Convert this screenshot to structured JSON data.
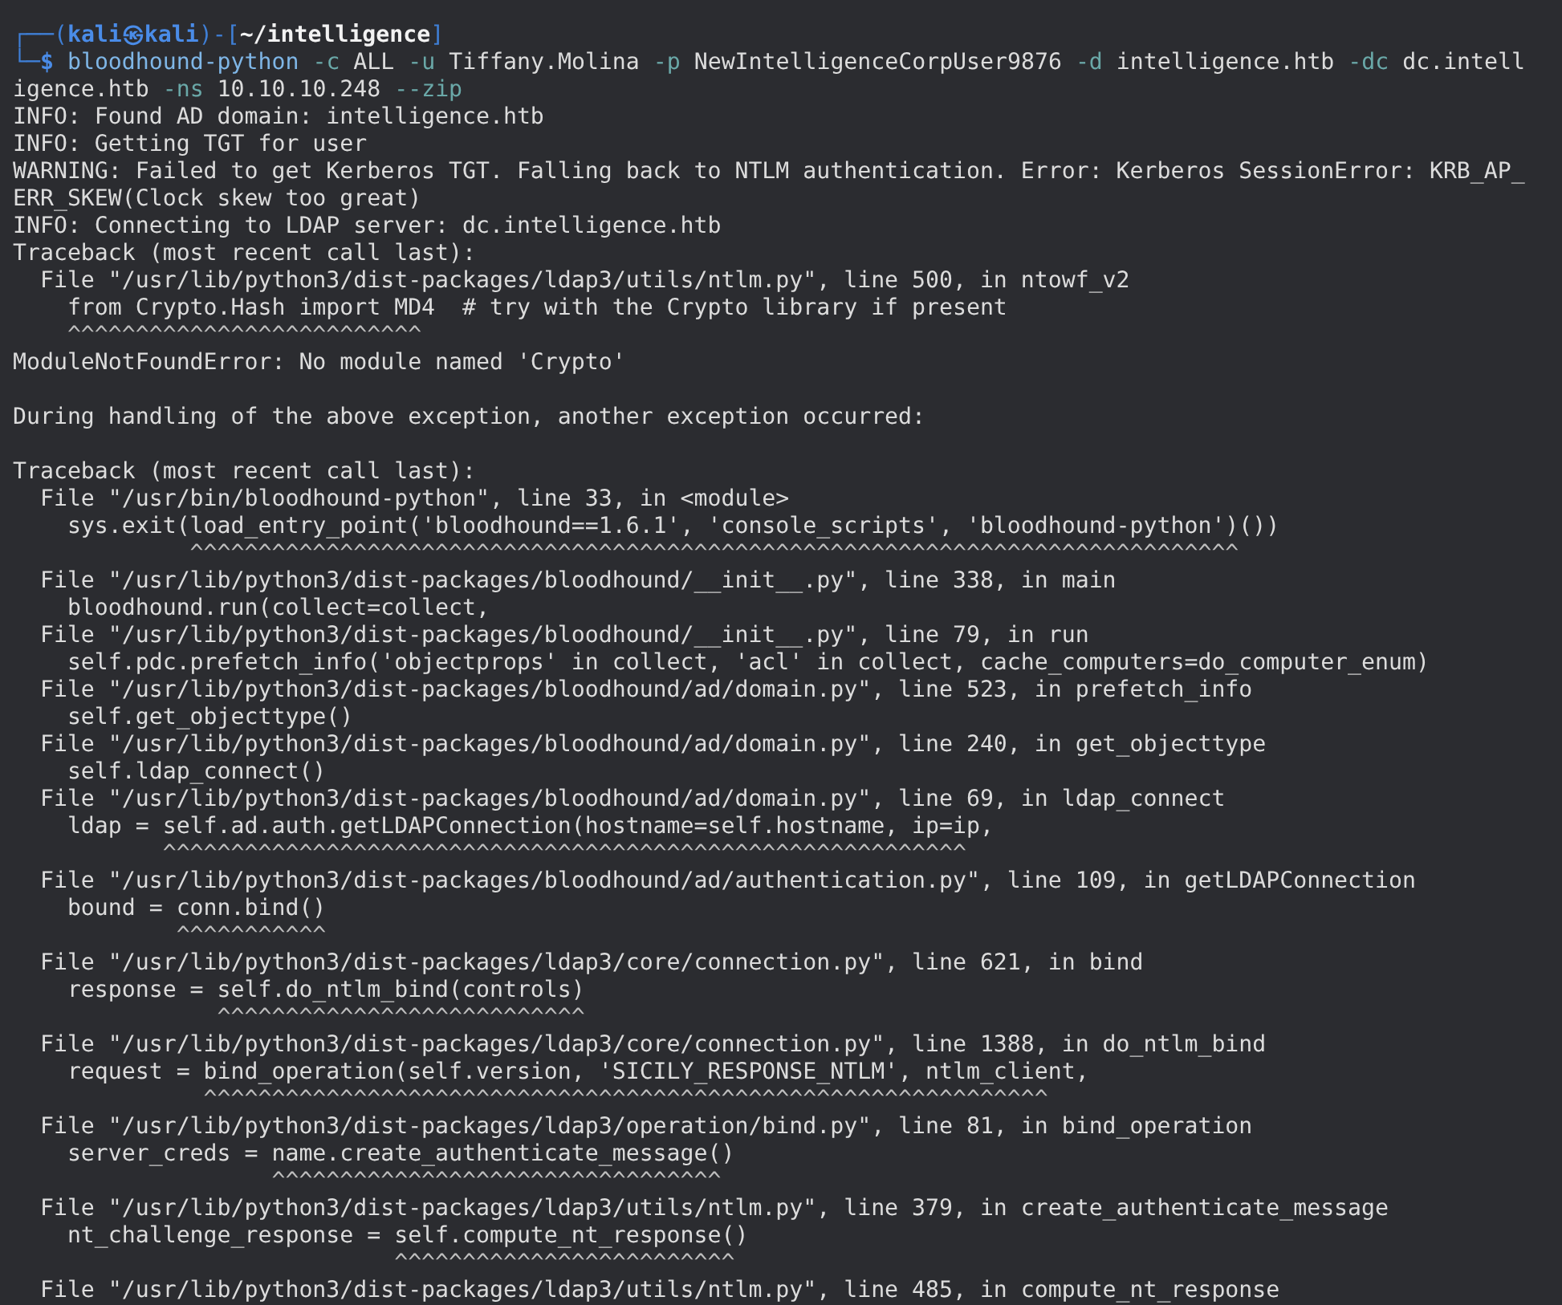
{
  "terminal": {
    "prompt": [
      {
        "kind": "frame",
        "text": "┌──("
      },
      {
        "kind": "user",
        "text": "kali㉿kali"
      },
      {
        "kind": "frame",
        "text": ")-["
      },
      {
        "kind": "path",
        "text": "~/intelligence"
      },
      {
        "kind": "frame",
        "text": "]"
      }
    ],
    "command_lines": [
      [
        {
          "kind": "frame",
          "text": "└─"
        },
        {
          "kind": "symbol",
          "text": "$ "
        },
        {
          "kind": "command",
          "text": "bloodhound-python"
        },
        {
          "kind": "option",
          "text": " -c"
        },
        {
          "kind": "arg",
          "text": " ALL "
        },
        {
          "kind": "option",
          "text": "-u"
        },
        {
          "kind": "arg",
          "text": " Tiffany.Molina "
        },
        {
          "kind": "option",
          "text": "-p"
        },
        {
          "kind": "arg",
          "text": " NewIntelligenceCorpUser9876 "
        },
        {
          "kind": "option",
          "text": "-d"
        },
        {
          "kind": "arg",
          "text": " intelligence.htb "
        },
        {
          "kind": "option",
          "text": "-dc"
        },
        {
          "kind": "arg",
          "text": " dc.intell"
        }
      ],
      [
        {
          "kind": "arg",
          "text": "igence.htb "
        },
        {
          "kind": "option",
          "text": "-ns"
        },
        {
          "kind": "arg",
          "text": " 10.10.10.248 "
        },
        {
          "kind": "option",
          "text": "--zip"
        }
      ]
    ],
    "output": [
      {
        "kind": "line",
        "text": "INFO: Found AD domain: intelligence.htb"
      },
      {
        "kind": "line",
        "text": "INFO: Getting TGT for user"
      },
      {
        "kind": "line",
        "text": "WARNING: Failed to get Kerberos TGT. Falling back to NTLM authentication. Error: Kerberos SessionError: KRB_AP_"
      },
      {
        "kind": "line",
        "text": "ERR_SKEW(Clock skew too great)"
      },
      {
        "kind": "line",
        "text": "INFO: Connecting to LDAP server: dc.intelligence.htb"
      },
      {
        "kind": "line",
        "text": "Traceback (most recent call last):"
      },
      {
        "kind": "line",
        "text": "  File \"/usr/lib/python3/dist-packages/ldap3/utils/ntlm.py\", line 500, in ntowf_v2"
      },
      {
        "kind": "line",
        "text": "    from Crypto.Hash import MD4  # try with the Crypto library if present"
      },
      {
        "kind": "caret",
        "text": "    ^^^^^^^^^^^^^^^^^^^^^^^^^^"
      },
      {
        "kind": "line",
        "text": "ModuleNotFoundError: No module named 'Crypto'"
      },
      {
        "kind": "blank"
      },
      {
        "kind": "line",
        "text": "During handling of the above exception, another exception occurred:"
      },
      {
        "kind": "blank"
      },
      {
        "kind": "line",
        "text": "Traceback (most recent call last):"
      },
      {
        "kind": "line",
        "text": "  File \"/usr/bin/bloodhound-python\", line 33, in <module>"
      },
      {
        "kind": "line",
        "text": "    sys.exit(load_entry_point('bloodhound==1.6.1', 'console_scripts', 'bloodhound-python')())"
      },
      {
        "kind": "caret",
        "text": "             ^^^^^^^^^^^^^^^^^^^^^^^^^^^^^^^^^^^^^^^^^^^^^^^^^^^^^^^^^^^^^^^^^^^^^^^^^^^^^"
      },
      {
        "kind": "line",
        "text": "  File \"/usr/lib/python3/dist-packages/bloodhound/__init__.py\", line 338, in main"
      },
      {
        "kind": "line",
        "text": "    bloodhound.run(collect=collect,"
      },
      {
        "kind": "line",
        "text": "  File \"/usr/lib/python3/dist-packages/bloodhound/__init__.py\", line 79, in run"
      },
      {
        "kind": "line",
        "text": "    self.pdc.prefetch_info('objectprops' in collect, 'acl' in collect, cache_computers=do_computer_enum)"
      },
      {
        "kind": "line",
        "text": "  File \"/usr/lib/python3/dist-packages/bloodhound/ad/domain.py\", line 523, in prefetch_info"
      },
      {
        "kind": "line",
        "text": "    self.get_objecttype()"
      },
      {
        "kind": "line",
        "text": "  File \"/usr/lib/python3/dist-packages/bloodhound/ad/domain.py\", line 240, in get_objecttype"
      },
      {
        "kind": "line",
        "text": "    self.ldap_connect()"
      },
      {
        "kind": "line",
        "text": "  File \"/usr/lib/python3/dist-packages/bloodhound/ad/domain.py\", line 69, in ldap_connect"
      },
      {
        "kind": "line",
        "text": "    ldap = self.ad.auth.getLDAPConnection(hostname=self.hostname, ip=ip,"
      },
      {
        "kind": "caret",
        "text": "           ^^^^^^^^^^^^^^^^^^^^^^^^^^^^^^^^^^^^^^^^^^^^^^^^^^^^^^^^^^^"
      },
      {
        "kind": "line",
        "text": "  File \"/usr/lib/python3/dist-packages/bloodhound/ad/authentication.py\", line 109, in getLDAPConnection"
      },
      {
        "kind": "line",
        "text": "    bound = conn.bind()"
      },
      {
        "kind": "caret",
        "text": "            ^^^^^^^^^^^"
      },
      {
        "kind": "line",
        "text": "  File \"/usr/lib/python3/dist-packages/ldap3/core/connection.py\", line 621, in bind"
      },
      {
        "kind": "line",
        "text": "    response = self.do_ntlm_bind(controls)"
      },
      {
        "kind": "caret",
        "text": "               ^^^^^^^^^^^^^^^^^^^^^^^^^^^"
      },
      {
        "kind": "line",
        "text": "  File \"/usr/lib/python3/dist-packages/ldap3/core/connection.py\", line 1388, in do_ntlm_bind"
      },
      {
        "kind": "line",
        "text": "    request = bind_operation(self.version, 'SICILY_RESPONSE_NTLM', ntlm_client,"
      },
      {
        "kind": "caret",
        "text": "              ^^^^^^^^^^^^^^^^^^^^^^^^^^^^^^^^^^^^^^^^^^^^^^^^^^^^^^^^^^^^^^"
      },
      {
        "kind": "line",
        "text": "  File \"/usr/lib/python3/dist-packages/ldap3/operation/bind.py\", line 81, in bind_operation"
      },
      {
        "kind": "line",
        "text": "    server_creds = name.create_authenticate_message()"
      },
      {
        "kind": "caret",
        "text": "                   ^^^^^^^^^^^^^^^^^^^^^^^^^^^^^^^^^"
      },
      {
        "kind": "line",
        "text": "  File \"/usr/lib/python3/dist-packages/ldap3/utils/ntlm.py\", line 379, in create_authenticate_message"
      },
      {
        "kind": "line",
        "text": "    nt_challenge_response = self.compute_nt_response()"
      },
      {
        "kind": "caret",
        "text": "                            ^^^^^^^^^^^^^^^^^^^^^^^^^"
      },
      {
        "kind": "line",
        "text": "  File \"/usr/lib/python3/dist-packages/ldap3/utils/ntlm.py\", line 485, in compute_nt_response"
      }
    ]
  }
}
